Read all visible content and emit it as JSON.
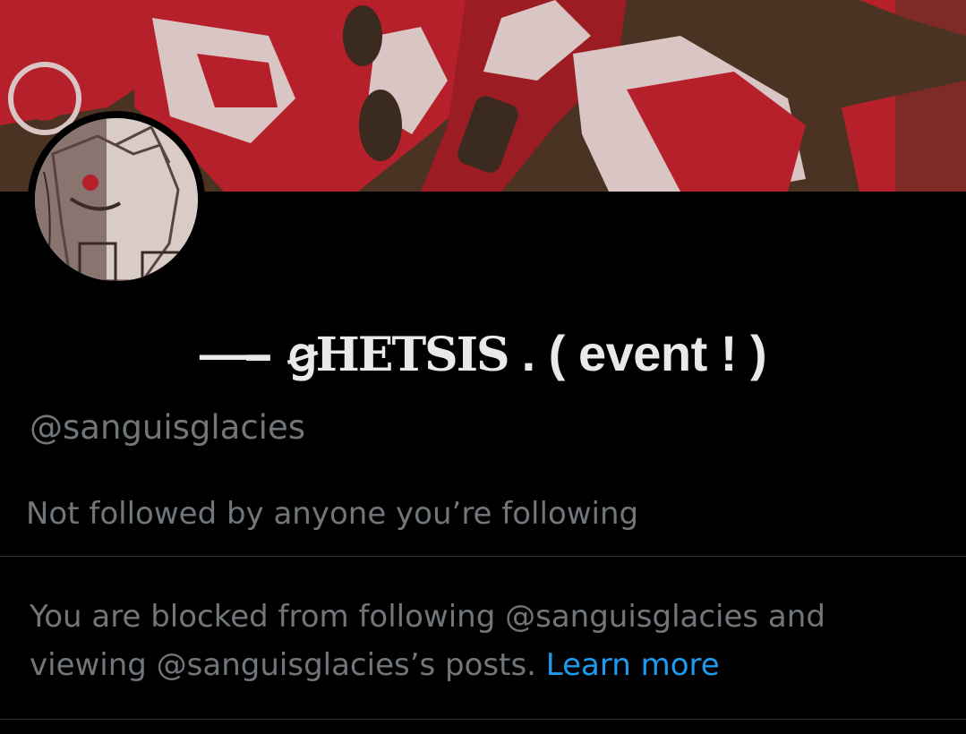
{
  "profile": {
    "display_name_prefix": "—-- ",
    "display_name_fancy": "ꞡHETSIS",
    "display_name_suffix": " . ( event ! )",
    "handle": "@sanguisglacies",
    "followers_note": "Not followed by anyone you’re following"
  },
  "blocked_notice": {
    "text": "You are blocked from following @sanguisglacies and viewing @sanguisglacies’s posts.",
    "link_label": "Learn more"
  },
  "colors": {
    "background": "#000000",
    "primary_text": "#e7e9ea",
    "secondary_text": "#71767b",
    "link": "#1d9bf0",
    "banner_red": "#b5202a",
    "banner_brown": "#4a3322",
    "banner_pink": "#d9c6c4"
  }
}
